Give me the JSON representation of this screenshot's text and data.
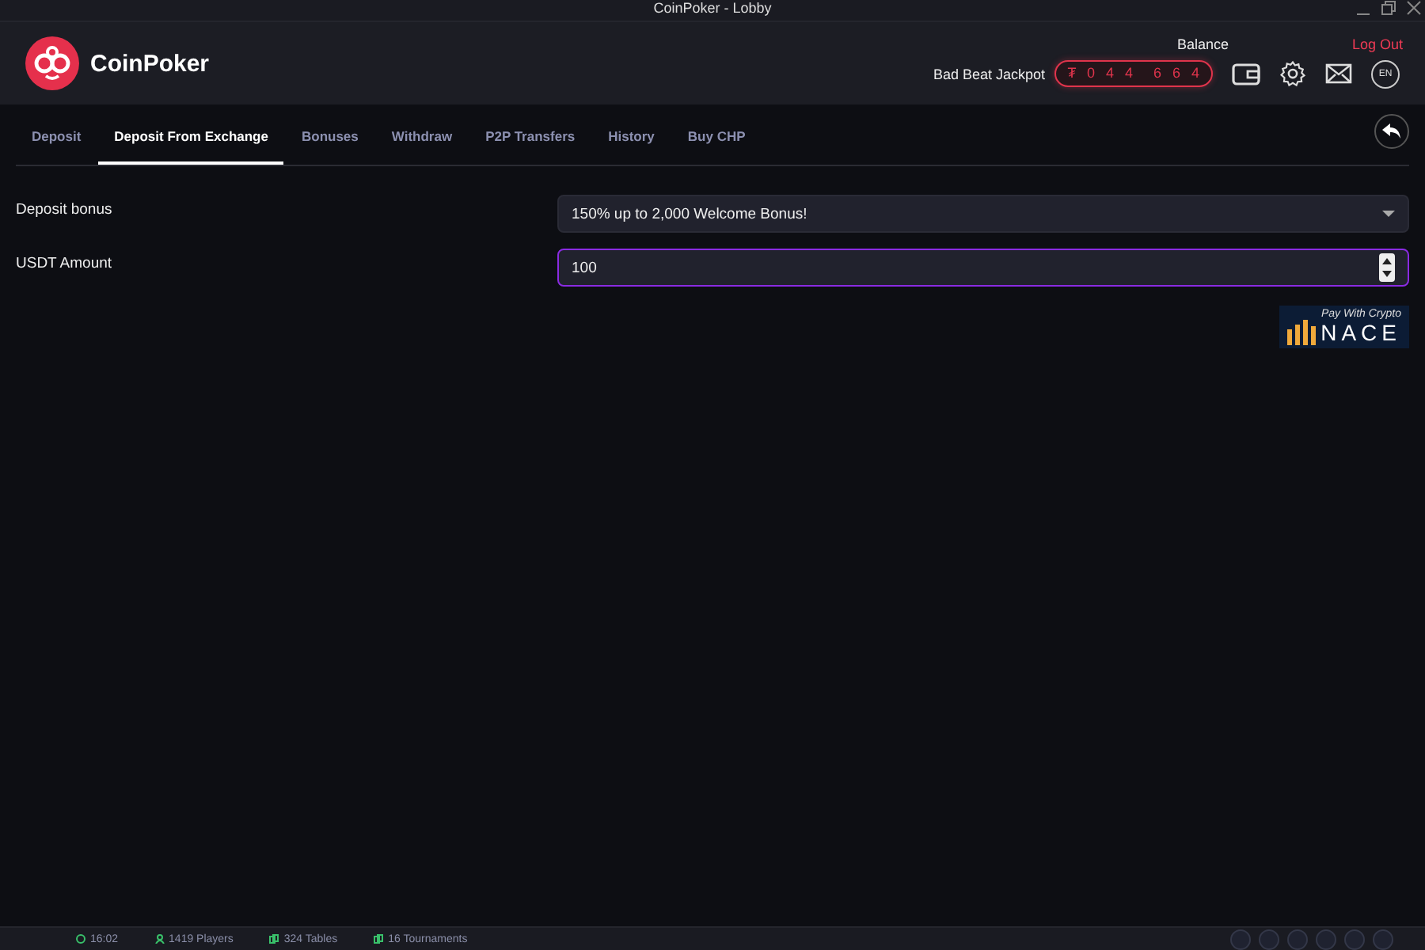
{
  "window": {
    "title": "CoinPoker - Lobby"
  },
  "header": {
    "brand": "CoinPoker",
    "balance_label": "Balance",
    "logout": "Log Out",
    "jackpot_label": "Bad Beat Jackpot",
    "jackpot_digits": [
      "₮",
      "0",
      "4",
      "4",
      "6",
      "6",
      "4"
    ],
    "language": "EN"
  },
  "tabs": [
    {
      "label": "Deposit",
      "selected": false
    },
    {
      "label": "Deposit From Exchange",
      "selected": true
    },
    {
      "label": "Bonuses",
      "selected": false
    },
    {
      "label": "Withdraw",
      "selected": false
    },
    {
      "label": "P2P Transfers",
      "selected": false
    },
    {
      "label": "History",
      "selected": false
    },
    {
      "label": "Buy CHP",
      "selected": false
    }
  ],
  "form": [
    {
      "kind": "select",
      "label": "Deposit bonus",
      "value": "150% up to 2,000 Welcome Bonus!",
      "focused": false
    },
    {
      "kind": "number",
      "label": "USDT Amount",
      "value": "100",
      "focused": true
    }
  ],
  "pay_badge": {
    "caption": "Pay With Crypto",
    "brand": "NACE"
  },
  "status_bar": {
    "time": "16:02",
    "players": "1419 Players",
    "tables": "324 Tables",
    "tournaments": "16 Tournaments"
  }
}
